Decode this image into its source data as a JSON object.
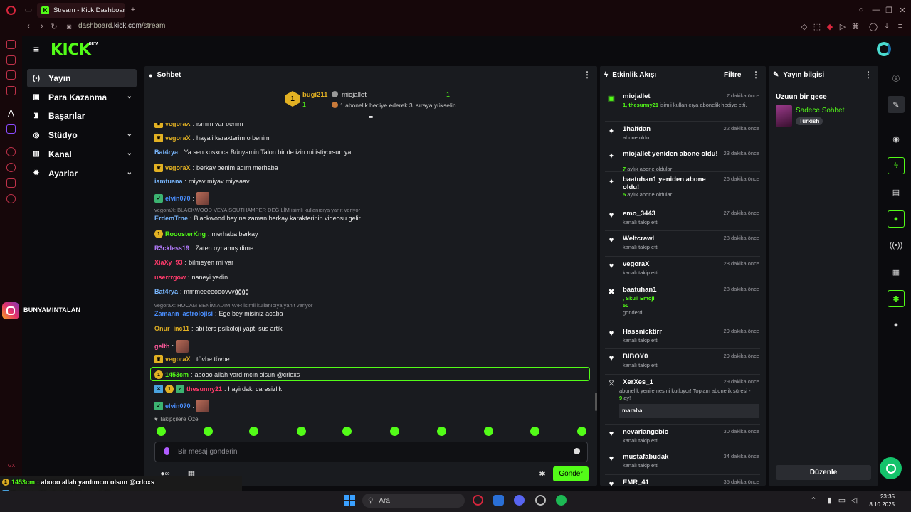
{
  "browser": {
    "tab_title": "Stream - Kick Dashboard",
    "url_prefix": "dashboard.",
    "url_domain": "kick.com",
    "url_path": "/stream"
  },
  "brand": {
    "logo": "KICK",
    "beta": "BETA",
    "accent": "#53fc18"
  },
  "nav": [
    {
      "label": "Yayın",
      "icon": "broadcast-icon",
      "selected": true
    },
    {
      "label": "Para Kazanma",
      "icon": "money-icon",
      "chevron": true
    },
    {
      "label": "Başarılar",
      "icon": "trophy-icon"
    },
    {
      "label": "Stüdyo",
      "icon": "studio-icon",
      "chevron": true
    },
    {
      "label": "Kanal",
      "icon": "channel-icon",
      "chevron": true
    },
    {
      "label": "Ayarlar",
      "icon": "gear-icon",
      "chevron": true
    }
  ],
  "overlay_social": {
    "handle": "BUNYAMINTALAN"
  },
  "chat": {
    "title": "Sohbet",
    "pinned": {
      "user1": "bugi211",
      "count1": "1",
      "user2": "miojallet",
      "count2": "1",
      "message": "1 abonelik hediye ederek 3. sıraya yükselin"
    },
    "messages": [
      {
        "user": "vegoraX",
        "color": "#e2b123",
        "text": "ismim var benim",
        "badge": "crown"
      },
      {
        "user": "vegoraX",
        "color": "#e2b123",
        "text": "hayali karakterim o benim",
        "badge": "crown"
      },
      {
        "user": "Bat4rya",
        "color": "#7ab8ff",
        "text": "Ya sen koskoca Bünyamin Talon bir de izin mi istiyorsun ya"
      },
      {
        "user": "vegoraX",
        "color": "#e2b123",
        "text": "berkay benim adım merhaba",
        "badge": "crown"
      },
      {
        "user": "iamtuana",
        "color": "#7ab8ff",
        "text": "miyav miyav miyaaav"
      },
      {
        "user": "elvin070",
        "color": "#4a8fff",
        "text": "",
        "badge": "ver",
        "emote": true
      },
      {
        "reply": "vegoraX: BLACKWOOD VEYA SOUTHAMPER DEĞİLİM isimli kullanıcıya yanıt veriyor"
      },
      {
        "user": "ErdemTrne",
        "color": "#7ab8ff",
        "text": "Blackwood bey ne zaman berkay karakterinin videosu gelir"
      },
      {
        "user": "RooosterKng",
        "color": "#53fc18",
        "text": "merhaba berkay",
        "badge": "sub"
      },
      {
        "user": "R3ckless19",
        "color": "#b57cff",
        "text": "Zaten oynamış dime"
      },
      {
        "user": "XiaXy_93",
        "color": "#ff3b6b",
        "text": "bilmeyen mi var"
      },
      {
        "user": "userrrgow",
        "color": "#ff3b6b",
        "text": "naneyi yedin"
      },
      {
        "user": "Bat4rya",
        "color": "#7ab8ff",
        "text": "mmmeeeeooovvvğğğğ"
      },
      {
        "reply": "vegoraX: HOCAM BENİM ADIM VAR isimli kullanıcıya yanıt veriyor"
      },
      {
        "user": "Zamann_astrolojisi",
        "color": "#4a8fff",
        "text": "Ege bey misiniz acaba"
      },
      {
        "user": "Onur_inc11",
        "color": "#e2b123",
        "text": "abi ters psikoloji yaptı sus artik"
      },
      {
        "user": "gelth",
        "color": "#ff5a9c",
        "text": "",
        "emote": true
      },
      {
        "user": "vegoraX",
        "color": "#e2b123",
        "text": "tövbe tövbe",
        "badge": "crown"
      },
      {
        "user": "1453cm",
        "color": "#53fc18",
        "text": "abooo allah yardımcın olsun @crloxs",
        "badge": "sub",
        "highlight": true
      },
      {
        "user": "thesunny21",
        "color": "#ff3b6b",
        "text": "hayirdaki caresizlik",
        "badge": "multi"
      },
      {
        "user": "elvin070",
        "color": "#4a8fff",
        "text": "",
        "badge": "ver",
        "emote": true
      }
    ],
    "mode_label": "Takipçilere Özel",
    "input_placeholder": "Bir mesaj gönderin",
    "send_label": "Gönder"
  },
  "activity": {
    "title": "Etkinlik Akışı",
    "filter": "Filtre",
    "items": [
      {
        "icon": "gift-icon",
        "name": "miojallet",
        "time": "7 dakika önce",
        "desc_pre": "",
        "desc_hl": "1, thesunny21",
        "desc": " isimli kullanıcıya abonelik hediye etti."
      },
      {
        "icon": "sparkle-icon",
        "name": "1halfdan",
        "time": "22 dakika önce",
        "desc": "abone oldu"
      },
      {
        "icon": "sparkle-icon",
        "name": "miojallet yeniden abone oldu!",
        "time": "23 dakika önce",
        "desc_hl": "7",
        "desc": " aylık abone oldular"
      },
      {
        "icon": "sparkle-icon",
        "name": "baatuhan1 yeniden abone oldu!",
        "time": "26 dakika önce",
        "desc_hl": "5",
        "desc": " aylık abone oldular"
      },
      {
        "icon": "heart-icon",
        "name": "emo_3443",
        "time": "27 dakika önce",
        "desc": "kanalı takip etti"
      },
      {
        "icon": "heart-icon",
        "name": "Weltcrawl",
        "time": "28 dakika önce",
        "desc": "kanalı takip etti"
      },
      {
        "icon": "heart-icon",
        "name": "vegoraX",
        "time": "28 dakika önce",
        "desc": "kanalı takip etti"
      },
      {
        "icon": "kick-coin-icon",
        "name": "baatuhan1",
        "time": "28 dakika önce",
        "desc_hl": ", Skull Emoji",
        "desc2_hl": "50",
        "desc": "gönderdi"
      },
      {
        "icon": "heart-icon",
        "name": "Hassnicktirr",
        "time": "29 dakika önce",
        "desc": "kanalı takip etti"
      },
      {
        "icon": "heart-icon",
        "name": "BIBOY0",
        "time": "29 dakika önce",
        "desc": "kanalı takip etti"
      },
      {
        "icon": "renew-icon",
        "name": "XerXes_1",
        "time": "29 dakika önce",
        "desc": "abonelik yenilemesini kutluyor! Toplam abonelik süresi - ",
        "desc_hl": "9",
        "desc_post": " ay!",
        "note": "maraba"
      },
      {
        "icon": "heart-icon",
        "name": "nevarlangeblo",
        "time": "30 dakika önce",
        "desc": "kanalı takip etti"
      },
      {
        "icon": "heart-icon",
        "name": "mustafabudak",
        "time": "34 dakika önce",
        "desc": "kanalı takip etti"
      },
      {
        "icon": "heart-icon",
        "name": "EMR_41",
        "time": "35 dakika önce",
        "desc": ""
      }
    ]
  },
  "stream_info": {
    "title": "Yayın bilgisi",
    "stream_title": "Uzuun bir gece",
    "category": "Sadece Sohbet",
    "tag": "Turkish",
    "edit_label": "Düzenle"
  },
  "taskbar": {
    "search": "Ara",
    "time": "23:35",
    "date": "8.10.2025"
  },
  "overlay_chat": [
    {
      "user": "1453cm",
      "color": "#53fc18",
      "text": ": abooo allah yardımcın olsun @crloxs"
    },
    {
      "user": "thesunny21",
      "color": "#ff3b6b",
      "text": ": hayirdaki caresizlik"
    },
    {
      "user": "elvin070",
      "color": "#4a8fff",
      "text": ":"
    }
  ]
}
